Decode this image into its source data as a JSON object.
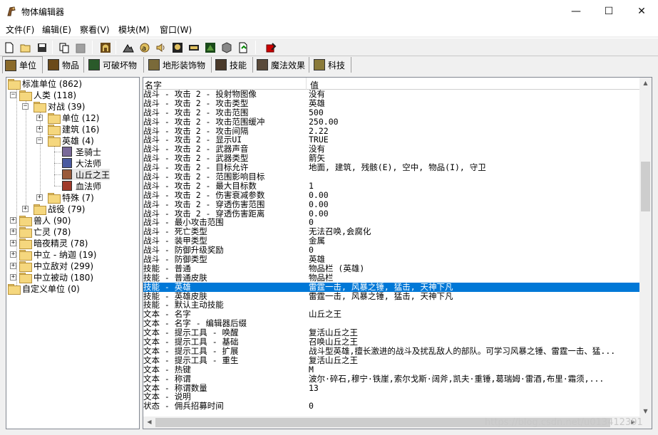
{
  "window": {
    "title": "物体编辑器",
    "minimize": "—",
    "maximize": "☐",
    "close": "✕"
  },
  "menu": [
    "文件(F)",
    "编辑(E)",
    "察看(V)",
    "模块(M)",
    "窗口(W)"
  ],
  "tabs": [
    {
      "label": "单位",
      "active": true
    },
    {
      "label": "物品",
      "active": false
    },
    {
      "label": "可破坏物",
      "active": false
    },
    {
      "label": "地形装饰物",
      "active": false
    },
    {
      "label": "技能",
      "active": false
    },
    {
      "label": "魔法效果",
      "active": false
    },
    {
      "label": "科技",
      "active": false
    }
  ],
  "tree": [
    {
      "label": "标准单位 (862)"
    },
    {
      "label": "人类 (118)"
    },
    {
      "label": "对战 (39)"
    },
    {
      "label": "单位 (12)"
    },
    {
      "label": "建筑 (16)"
    },
    {
      "label": "英雄 (4)"
    },
    {
      "label": "圣骑士"
    },
    {
      "label": "大法师"
    },
    {
      "label": "山丘之王"
    },
    {
      "label": "血法师"
    },
    {
      "label": "特殊 (7)"
    },
    {
      "label": "战役 (79)"
    },
    {
      "label": "兽人 (90)"
    },
    {
      "label": "亡灵 (78)"
    },
    {
      "label": "暗夜精灵 (78)"
    },
    {
      "label": "中立 - 纳迦 (19)"
    },
    {
      "label": "中立敌对 (299)"
    },
    {
      "label": "中立被动 (180)"
    },
    {
      "label": "自定义单位 (0)"
    }
  ],
  "grid": {
    "col_name": "名字",
    "col_value": "值",
    "rows": [
      {
        "name": "战斗 - 攻击 2 - 投射物图像",
        "value": "没有"
      },
      {
        "name": "战斗 - 攻击 2 - 攻击类型",
        "value": "英雄"
      },
      {
        "name": "战斗 - 攻击 2 - 攻击范围",
        "value": "500"
      },
      {
        "name": "战斗 - 攻击 2 - 攻击范围缓冲",
        "value": "250.00"
      },
      {
        "name": "战斗 - 攻击 2 - 攻击间隔",
        "value": "2.22"
      },
      {
        "name": "战斗 - 攻击 2 - 显示UI",
        "value": "TRUE"
      },
      {
        "name": "战斗 - 攻击 2 - 武器声音",
        "value": "没有"
      },
      {
        "name": "战斗 - 攻击 2 - 武器类型",
        "value": "箭矢"
      },
      {
        "name": "战斗 - 攻击 2 - 目标允许",
        "value": "地面, 建筑, 残骸(E), 空中, 物品(I), 守卫"
      },
      {
        "name": "战斗 - 攻击 2 - 范围影响目标",
        "value": ""
      },
      {
        "name": "战斗 - 攻击 2 - 最大目标数",
        "value": "1"
      },
      {
        "name": "战斗 - 攻击 2 - 伤害衰减参数",
        "value": "0.00"
      },
      {
        "name": "战斗 - 攻击 2 - 穿透伤害范围",
        "value": "0.00"
      },
      {
        "name": "战斗 - 攻击 2 - 穿透伤害距离",
        "value": "0.00"
      },
      {
        "name": "战斗 - 最小攻击范围",
        "value": "0"
      },
      {
        "name": "战斗 - 死亡类型",
        "value": "无法召唤,会腐化"
      },
      {
        "name": "战斗 - 装甲类型",
        "value": "金属"
      },
      {
        "name": "战斗 - 防御升级奖励",
        "value": "0"
      },
      {
        "name": "战斗 - 防御类型",
        "value": "英雄"
      },
      {
        "name": "技能 - 普通",
        "value": "物品栏 (英雄)"
      },
      {
        "name": "技能 - 普通皮肤",
        "value": "物品栏"
      },
      {
        "name": "技能 - 英雄",
        "value": "雷霆一击, 风暴之锤, 猛击, 天神下凡"
      },
      {
        "name": "技能 - 英雄皮肤",
        "value": "雷霆一击, 风暴之锤, 猛击, 天神下凡"
      },
      {
        "name": "技能 - 默认主动技能",
        "value": ""
      },
      {
        "name": "文本 - 名字",
        "value": "山丘之王"
      },
      {
        "name": "文本 - 名字 - 编辑器后缀",
        "value": ""
      },
      {
        "name": "文本 - 提示工具 - 唤醒",
        "value": "复活山丘之王"
      },
      {
        "name": "文本 - 提示工具 - 基础",
        "value": "召唤山丘之王"
      },
      {
        "name": "文本 - 提示工具 - 扩展",
        "value": "战斗型英雄,擅长激进的战斗及扰乱敌人的部队。可学习风暴之锤、雷霆一击、猛..."
      },
      {
        "name": "文本 - 提示工具 - 重生",
        "value": "复活山丘之王"
      },
      {
        "name": "文本 - 热键",
        "value": "M"
      },
      {
        "name": "文本 - 称谓",
        "value": "波尔·碎石,穆宁·铁崖,索尔戈斯·阔斧,凯夫·重锤,葛瑞姆·雷酒,布里·霜须,..."
      },
      {
        "name": "文本 - 称谓数量",
        "value": "13"
      },
      {
        "name": "文本 - 说明",
        "value": ""
      },
      {
        "name": "状态 - 佣兵招募时间",
        "value": "0"
      }
    ],
    "selected_index": 21
  },
  "watermark": "https://blog.csdn.net/u013412391",
  "colors": {
    "selection": "#0078d7",
    "folder": "#f5d77e",
    "window_bg": "#f0f0f0"
  }
}
